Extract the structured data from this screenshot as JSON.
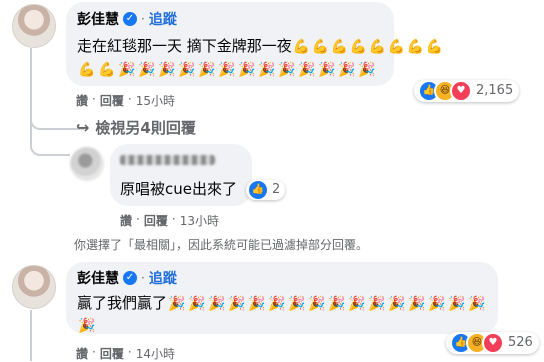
{
  "comment1": {
    "author": "彭佳慧",
    "follow": "追蹤",
    "text": "走在紅毯那一天 摘下金牌那一夜",
    "line1_emojis": [
      "💪",
      "💪",
      "💪",
      "💪",
      "💪",
      "💪",
      "💪",
      "💪"
    ],
    "line2_emojis": [
      "💪",
      "💪",
      "🎉",
      "🎉",
      "🎉",
      "🎉",
      "🎉",
      "🎉",
      "🎉",
      "🎉",
      "🎉",
      "🎉",
      "🎉",
      "🎉",
      "🎉"
    ],
    "actions": {
      "like": "讚",
      "reply": "回覆",
      "time": "15小時"
    },
    "reaction_count": "2,165"
  },
  "more_replies": "檢視另4則回覆",
  "reply": {
    "text": "原唱被cue出來了",
    "reaction_count": "2",
    "actions": {
      "like": "讚",
      "reply": "回覆",
      "time": "13小時"
    }
  },
  "filter_notice": "你選擇了「最相關」，因此系統可能已過濾掉部分回覆。",
  "comment2": {
    "author": "彭佳慧",
    "follow": "追蹤",
    "text": "贏了我們贏了",
    "line1_emojis": [
      "🎉",
      "🎉",
      "🎉",
      "🎉",
      "🎉",
      "🎉",
      "🎉",
      "🎉",
      "🎉",
      "🎉",
      "🎉",
      "🎉",
      "🎉",
      "🎉",
      "🎉",
      "🎉"
    ],
    "line2_emojis": [
      "🎉"
    ],
    "actions": {
      "like": "讚",
      "reply": "回覆",
      "time": "14小時"
    },
    "reaction_count": "526"
  },
  "colors": {
    "link": "#216fdb",
    "bubble": "#f0f2f5",
    "meta": "#65676b",
    "like": "#1877f2",
    "heart": "#f33e58"
  },
  "icons": [
    "verified-badge-icon",
    "like-reaction-icon",
    "haha-reaction-icon",
    "love-reaction-icon",
    "reply-arrow-icon"
  ]
}
